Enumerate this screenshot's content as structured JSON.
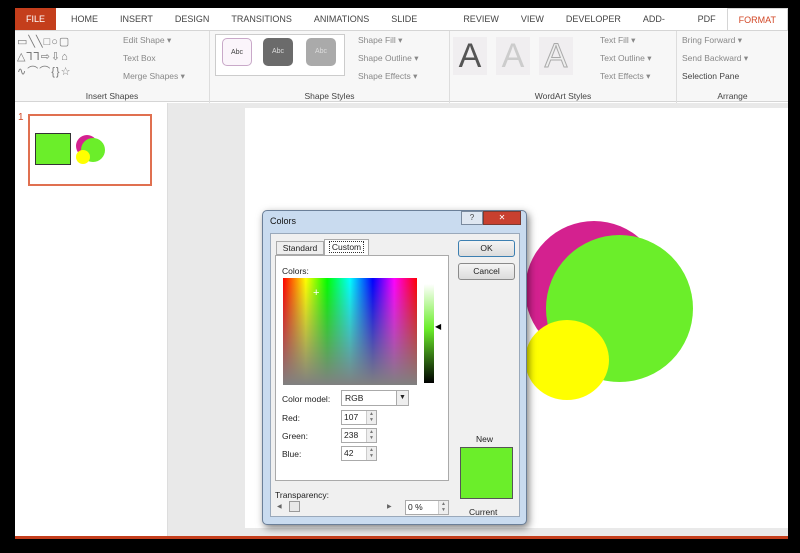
{
  "tabs": [
    "FILE",
    "HOME",
    "INSERT",
    "DESIGN",
    "TRANSITIONS",
    "ANIMATIONS",
    "SLIDE SHOW",
    "REVIEW",
    "VIEW",
    "DEVELOPER",
    "ADD-INS",
    "PDF",
    "FORMAT"
  ],
  "ribbon": {
    "insert_shapes": {
      "label": "Insert Shapes",
      "edit_shape": "Edit Shape ▾",
      "text_box": "Text Box",
      "merge_shapes": "Merge Shapes ▾"
    },
    "shape_styles": {
      "label": "Shape Styles",
      "style_text": "Abc",
      "shape_fill": "Shape Fill ▾",
      "shape_outline": "Shape Outline ▾",
      "shape_effects": "Shape Effects ▾"
    },
    "wordart_styles": {
      "label": "WordArt Styles",
      "letter": "A",
      "text_fill": "Text Fill ▾",
      "text_outline": "Text Outline ▾",
      "text_effects": "Text Effects ▾"
    },
    "arrange": {
      "label": "Arrange",
      "bring_forward": "Bring Forward ▾",
      "send_backward": "Send Backward ▾",
      "selection_pane": "Selection Pane"
    }
  },
  "slides": {
    "number": "1"
  },
  "shape_colors": {
    "magenta": "#d4218f",
    "green": "#6bee2a",
    "yellow": "#ffff00"
  },
  "dialog": {
    "title": "Colors",
    "help": "?",
    "close": "✕",
    "tabs": [
      "Standard",
      "Custom"
    ],
    "colors_label": "Colors:",
    "color_model_label": "Color model:",
    "color_model": "RGB",
    "red_label": "Red:",
    "red": "107",
    "green_label": "Green:",
    "green": "238",
    "blue_label": "Blue:",
    "blue": "42",
    "ok": "OK",
    "cancel": "Cancel",
    "new_label": "New",
    "current_label": "Current",
    "transparency_label": "Transparency:",
    "transparency": "0 %"
  }
}
